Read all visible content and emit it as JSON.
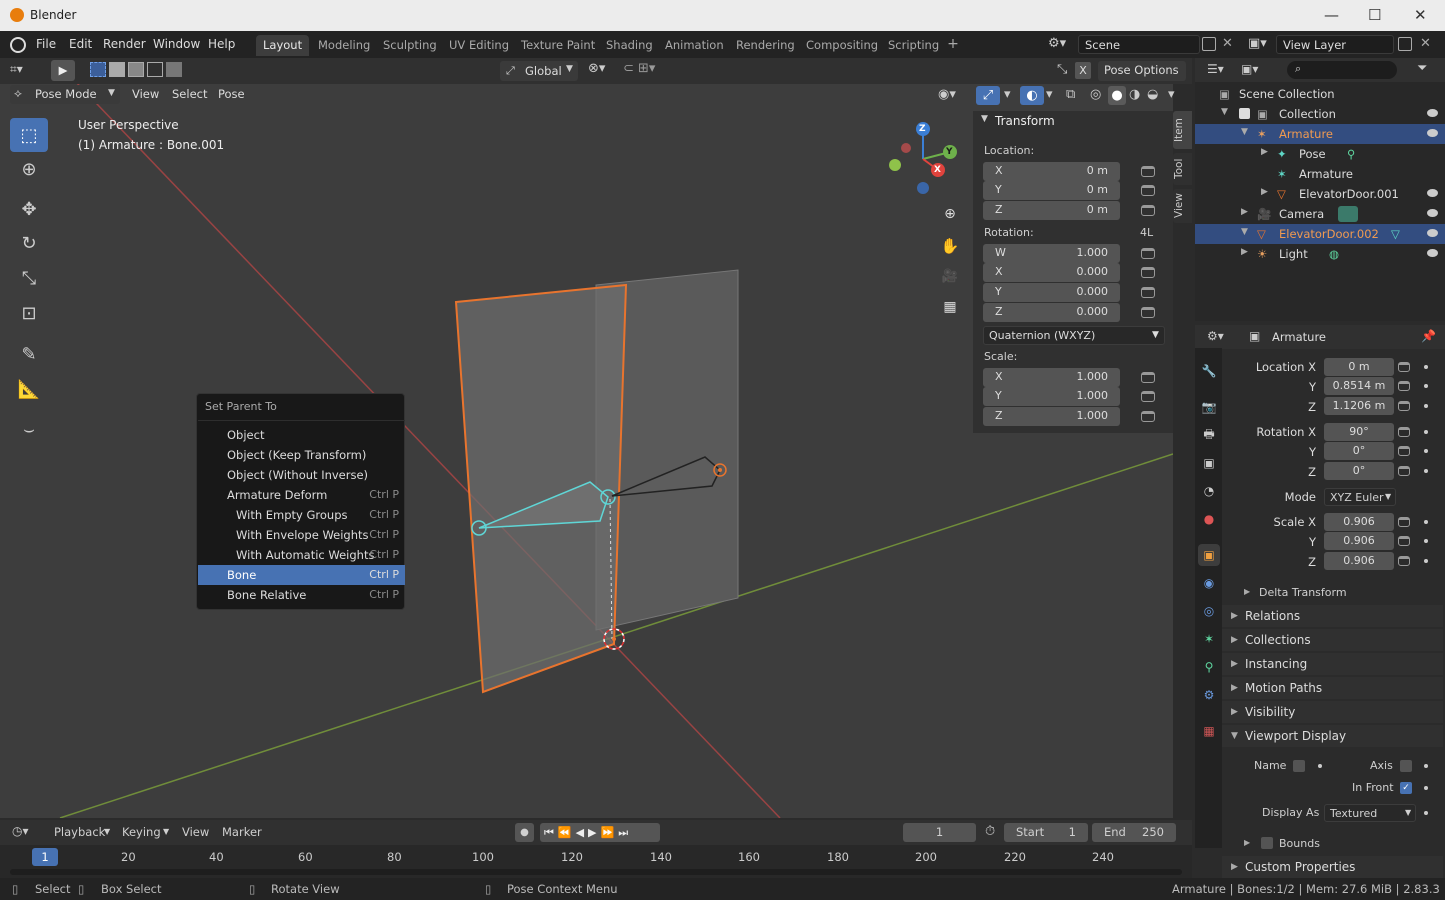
{
  "window": {
    "title": "Blender"
  },
  "menubar": {
    "menus": [
      "File",
      "Edit",
      "Render",
      "Window",
      "Help"
    ],
    "workspaces": [
      "Layout",
      "Modeling",
      "Sculpting",
      "UV Editing",
      "Texture Paint",
      "Shading",
      "Animation",
      "Rendering",
      "Compositing",
      "Scripting"
    ],
    "active_workspace": "Layout",
    "add_tab": "+",
    "scene": "Scene",
    "view_layer": "View Layer"
  },
  "viewport_header": {
    "transform_orientation": "Global",
    "mode": "Pose Mode",
    "menus": [
      "View",
      "Select",
      "Pose"
    ],
    "pose_options": "Pose Options"
  },
  "viewport_overlay": {
    "perspective": "User Perspective",
    "active": "(1) Armature : Bone.001",
    "axes": {
      "x": "X",
      "y": "Y",
      "z": "Z"
    }
  },
  "npanel": {
    "title": "Transform",
    "location_label": "Location:",
    "location": [
      {
        "axis": "X",
        "value": "0 m"
      },
      {
        "axis": "Y",
        "value": "0 m"
      },
      {
        "axis": "Z",
        "value": "0 m"
      }
    ],
    "rotation_label": "Rotation:",
    "rotation_mode_tag": "4L",
    "rotation": [
      {
        "axis": "W",
        "value": "1.000"
      },
      {
        "axis": "X",
        "value": "0.000"
      },
      {
        "axis": "Y",
        "value": "0.000"
      },
      {
        "axis": "Z",
        "value": "0.000"
      }
    ],
    "rotation_mode": "Quaternion (WXYZ)",
    "scale_label": "Scale:",
    "scale": [
      {
        "axis": "X",
        "value": "1.000"
      },
      {
        "axis": "Y",
        "value": "1.000"
      },
      {
        "axis": "Z",
        "value": "1.000"
      }
    ],
    "tabs": [
      "Item",
      "Tool",
      "View"
    ]
  },
  "context_menu": {
    "title": "Set Parent To",
    "items": [
      {
        "label": "Object",
        "shortcut": ""
      },
      {
        "label": "Object (Keep Transform)",
        "shortcut": ""
      },
      {
        "label": "Object (Without Inverse)",
        "shortcut": ""
      },
      {
        "label": "Armature Deform",
        "shortcut": "Ctrl P"
      },
      {
        "label": "With Empty Groups",
        "shortcut": "Ctrl P"
      },
      {
        "label": "With Envelope Weights",
        "shortcut": "Ctrl P"
      },
      {
        "label": "With Automatic Weights",
        "shortcut": "Ctrl P"
      },
      {
        "label": "Bone",
        "shortcut": "Ctrl P"
      },
      {
        "label": "Bone Relative",
        "shortcut": "Ctrl P"
      }
    ],
    "selected": "Bone"
  },
  "outliner": {
    "items": [
      {
        "label": "Scene Collection"
      },
      {
        "label": "Collection"
      },
      {
        "label": "Armature"
      },
      {
        "label": "Pose"
      },
      {
        "label": "Armature"
      },
      {
        "label": "ElevatorDoor.001"
      },
      {
        "label": "Camera"
      },
      {
        "label": "ElevatorDoor.002"
      },
      {
        "label": "Light"
      }
    ]
  },
  "properties": {
    "object_name": "Armature",
    "location": {
      "label": "Location X",
      "x": "0 m",
      "y": "0.8514 m",
      "z": "1.1206 m"
    },
    "rotation": {
      "label": "Rotation X",
      "x": "90°",
      "y": "0°",
      "z": "0°"
    },
    "mode_label": "Mode",
    "mode": "XYZ Euler",
    "scale": {
      "label": "Scale X",
      "x": "0.906",
      "y": "0.906",
      "z": "0.906"
    },
    "axis_y": "Y",
    "axis_z": "Z",
    "delta_transform": "Delta Transform",
    "sections": [
      "Relations",
      "Collections",
      "Instancing",
      "Motion Paths",
      "Visibility"
    ],
    "viewport_display": "Viewport Display",
    "vd": {
      "name": "Name",
      "axis": "Axis",
      "in_front": "In Front",
      "display_as_label": "Display As",
      "display_as": "Textured",
      "bounds": "Bounds"
    },
    "custom_properties": "Custom Properties"
  },
  "timeline": {
    "menus": [
      "Playback",
      "Keying",
      "View",
      "Marker"
    ],
    "current_frame": "1",
    "start_label": "Start",
    "start": "1",
    "end_label": "End",
    "end": "250",
    "ticks": [
      "20",
      "40",
      "60",
      "80",
      "100",
      "120",
      "140",
      "160",
      "180",
      "200",
      "220",
      "240"
    ],
    "frame_marker": "1"
  },
  "statusbar": {
    "select": "Select",
    "box_select": "Box Select",
    "rotate_view": "Rotate View",
    "context_menu": "Pose Context Menu",
    "info": "Armature | Bones:1/2  | Mem: 27.6 MiB | 2.83.3"
  },
  "colors": {
    "accent": "#4772b3",
    "selected_orange": "#e8742e",
    "bone_cyan": "#5fd6d6",
    "grid_red": "#b84545",
    "grid_green": "#7a9c3a"
  }
}
